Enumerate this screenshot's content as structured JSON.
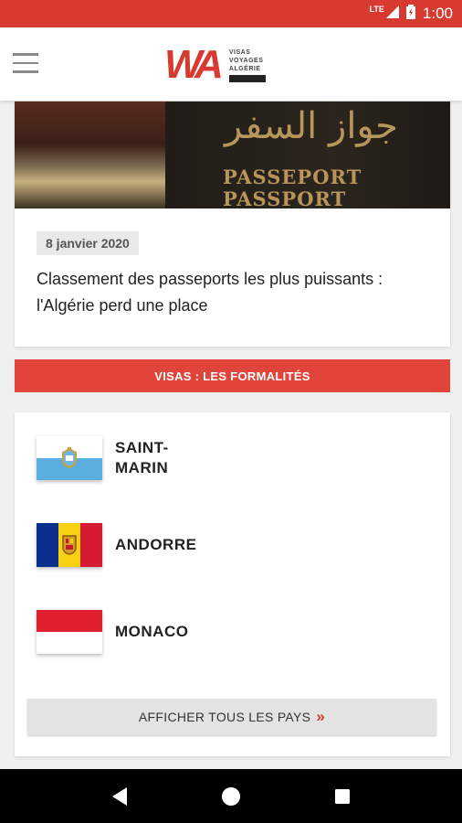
{
  "status_bar": {
    "network": "LTE",
    "time": "1:00"
  },
  "header": {
    "logo_mark": "WA",
    "logo_lines": [
      "VISAS",
      "VOYAGES",
      "ALGÉRIE"
    ]
  },
  "news": {
    "image_text_arabic": "جواز السفر",
    "image_text_passport": "PASSEPORT",
    "image_text_passport2": "PASSPORT",
    "date": "8 janvier 2020",
    "title": "Classement des passeports les plus puissants : l'Algérie perd une place"
  },
  "section": {
    "title": "VISAS : LES FORMALITÉS"
  },
  "countries": [
    {
      "name": "SAINT-MARIN",
      "flag": "san-marino-flag"
    },
    {
      "name": "ANDORRE",
      "flag": "andorra-flag"
    },
    {
      "name": "MONACO",
      "flag": "monaco-flag"
    }
  ],
  "show_all": {
    "label": "AFFICHER TOUS LES PAYS",
    "icon": "double-chevron-right-icon"
  },
  "colors": {
    "accent": "#d73a30",
    "banner": "#e0443a"
  }
}
